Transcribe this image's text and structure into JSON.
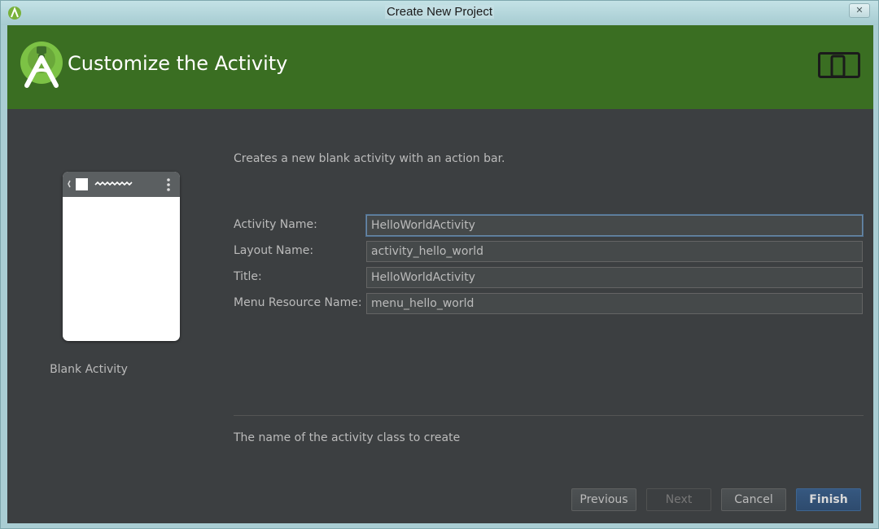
{
  "window": {
    "title": "Create New Project",
    "close_glyph": "✕"
  },
  "header": {
    "title": "Customize the Activity",
    "logo_icon": "android-studio-logo",
    "device_icon": "phone-tablet-icon",
    "background_color": "#3a6e22"
  },
  "preview": {
    "label": "Blank Activity"
  },
  "form": {
    "description": "Creates a new blank activity with an action bar.",
    "fields": [
      {
        "label": "Activity Name:",
        "value": "HelloWorldActivity"
      },
      {
        "label": "Layout Name:",
        "value": "activity_hello_world"
      },
      {
        "label": "Title:",
        "value": "HelloWorldActivity"
      },
      {
        "label": "Menu Resource Name:",
        "value": "menu_hello_world"
      }
    ],
    "help_text": "The name of the activity class to create"
  },
  "buttons": {
    "previous": "Previous",
    "next": "Next",
    "cancel": "Cancel",
    "finish": "Finish"
  },
  "colors": {
    "panel_background": "#3c3f41",
    "text": "#bbbbbb",
    "primary_button": "#365880"
  }
}
